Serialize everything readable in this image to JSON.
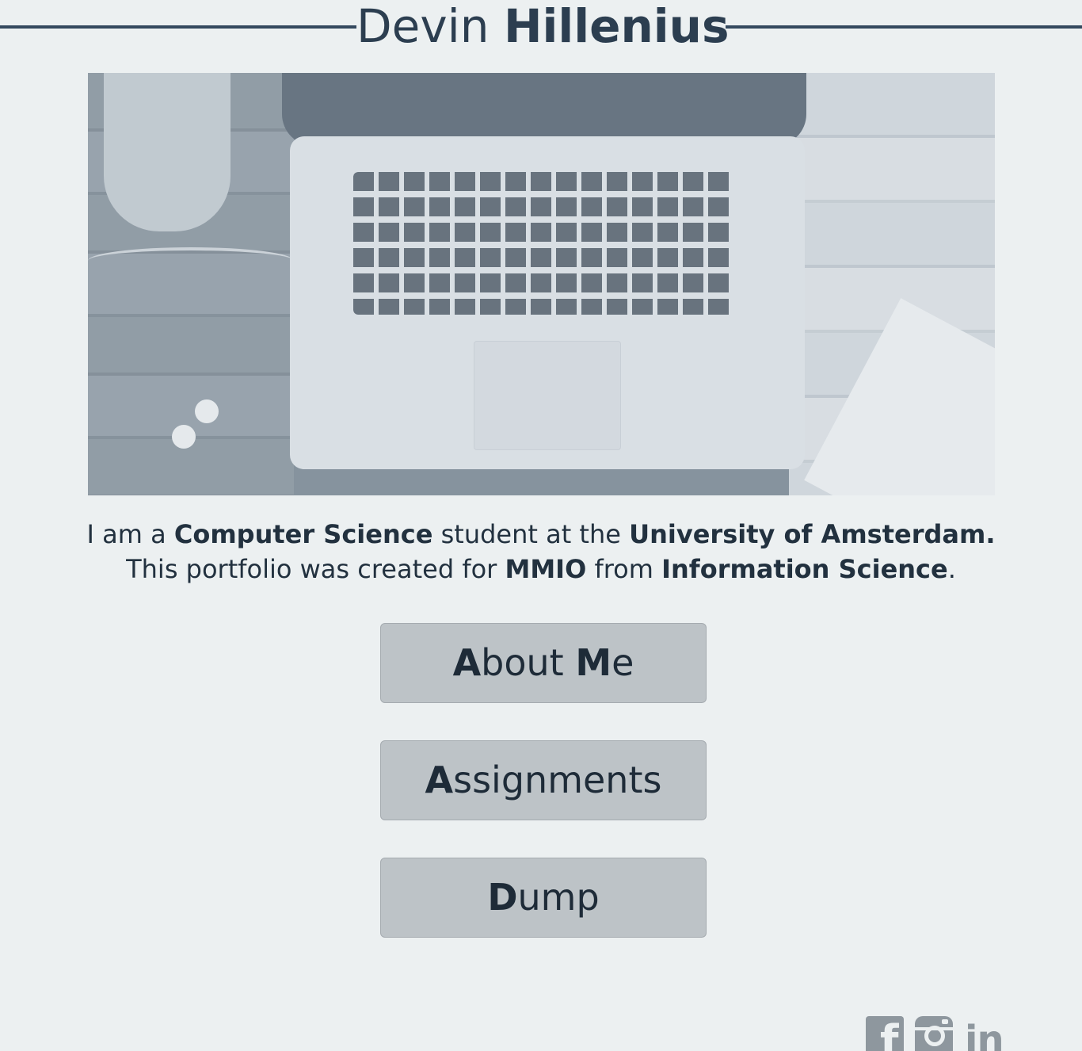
{
  "header": {
    "first_name": "Devin",
    "last_name": "Hillenius"
  },
  "hero": {
    "icon": "laptop-desk-photo"
  },
  "intro": {
    "line1": {
      "t1": "I am a ",
      "b1": "Computer Science",
      "t2": " student at the ",
      "b2": "University of Amsterdam",
      "t3": "."
    },
    "line2": {
      "t1": "This portfolio was created for ",
      "b1": "MMIO",
      "t2": " from ",
      "b2": "Information Science",
      "t3": "."
    }
  },
  "nav": {
    "about": {
      "cap": "A",
      "rest": "bout ",
      "cap2": "M",
      "rest2": "e"
    },
    "assignments": {
      "cap": "A",
      "rest": "ssignments"
    },
    "dump": {
      "cap": "D",
      "rest": "ump"
    }
  },
  "social": {
    "icons": [
      "facebook-icon",
      "instagram-icon",
      "linkedin-icon"
    ],
    "linkedin_text": "in",
    "facebook_text": "f"
  },
  "colors": {
    "background": "#ecf0f1",
    "text": "#2c3e50",
    "button": "#bdc3c7",
    "icon": "#8e979e"
  }
}
